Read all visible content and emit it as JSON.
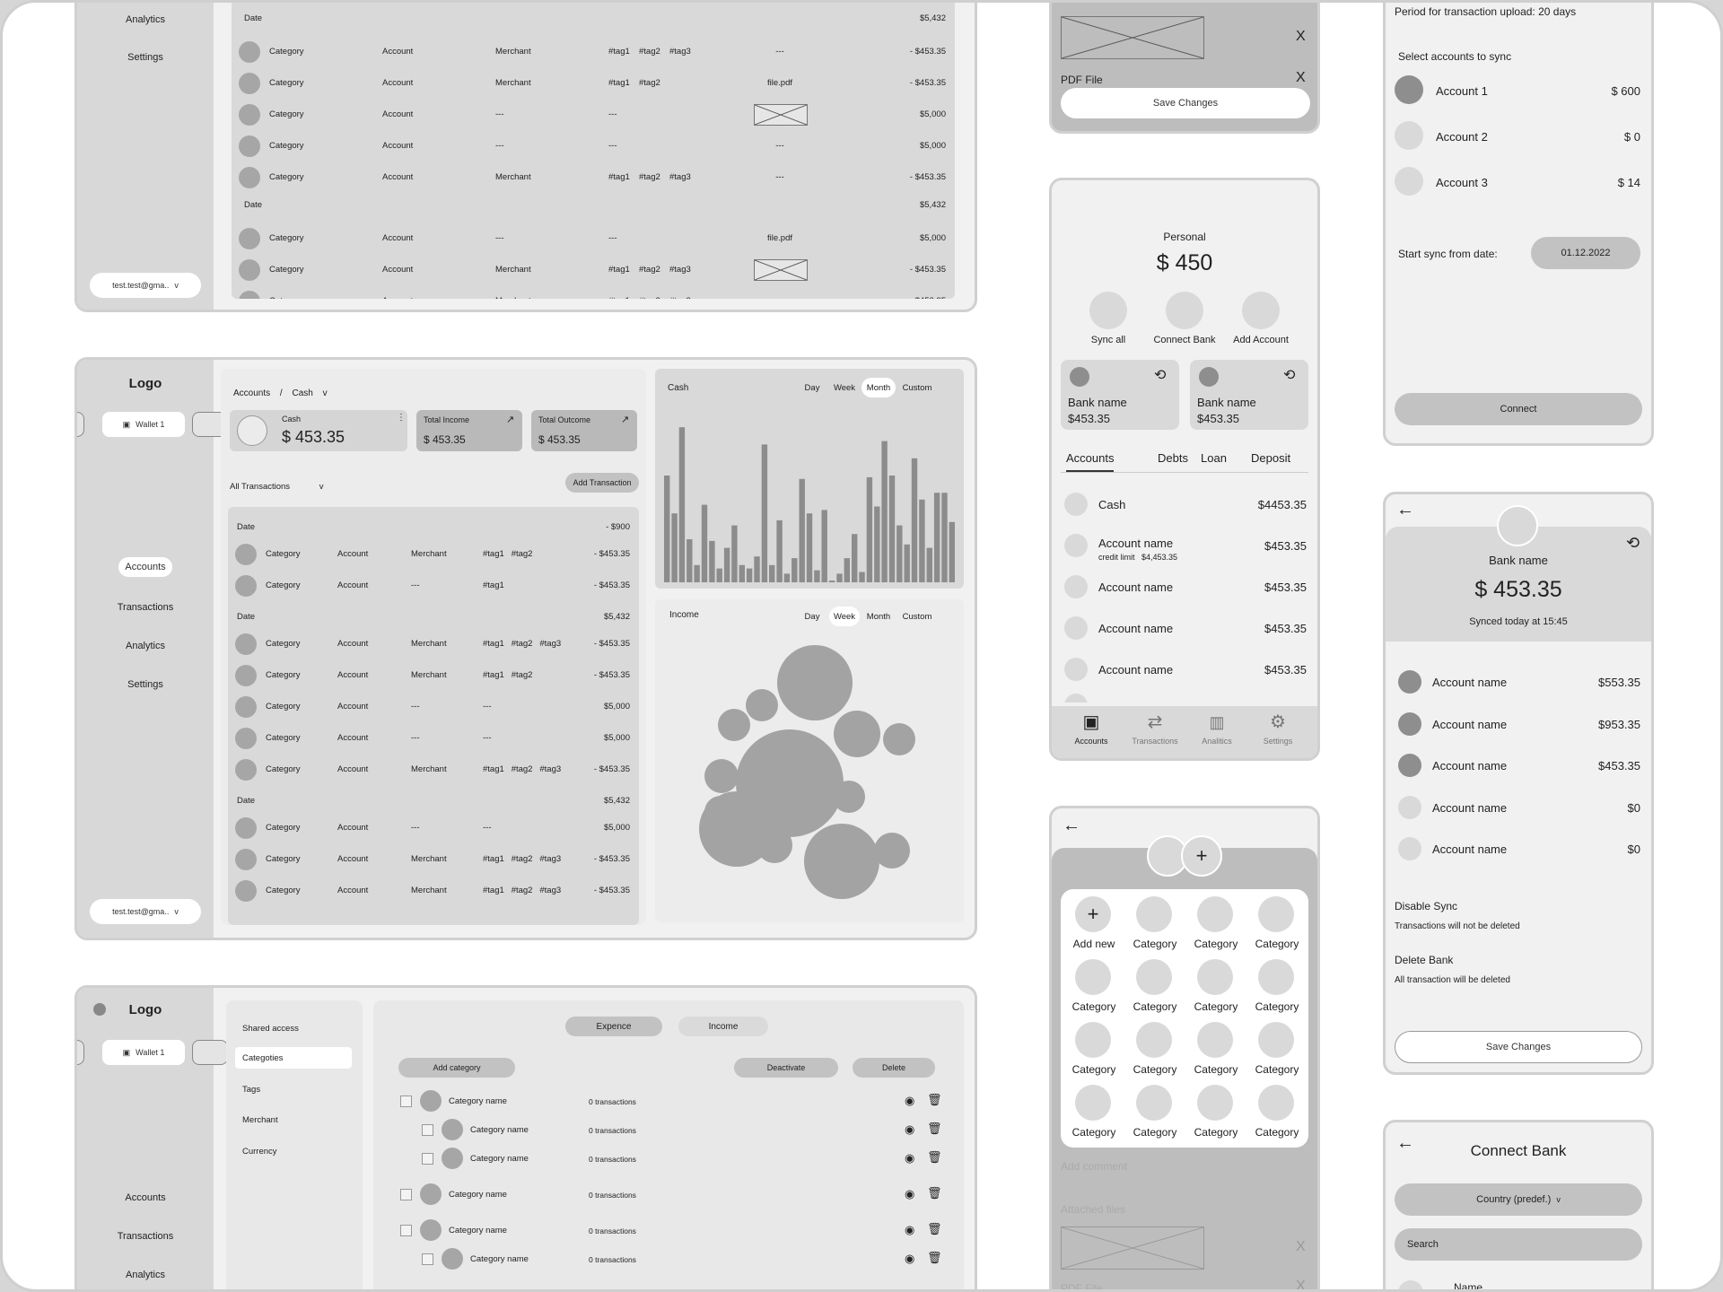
{
  "sidebar": {
    "analytics": "Analytics",
    "settings": "Settings",
    "accounts": "Accounts",
    "transactions": "Transactions",
    "logo": "Logo",
    "wallet": "Wallet 1",
    "email": "test.test@gma..",
    "chevron": "v"
  },
  "top_table": {
    "groups": [
      {
        "date": "Date",
        "total": "$5,432"
      },
      {
        "date": "Date",
        "total": "$5,432"
      }
    ],
    "rows": [
      {
        "category": "Category",
        "account": "Account",
        "merchant": "Merchant",
        "tags": [
          "#tag1",
          "#tag2",
          "#tag3"
        ],
        "file": "---",
        "amount": "- $453.35"
      },
      {
        "category": "Category",
        "account": "Account",
        "merchant": "Merchant",
        "tags": [
          "#tag1",
          "#tag2"
        ],
        "file": "file.pdf",
        "amount": "- $453.35"
      },
      {
        "category": "Category",
        "account": "Account",
        "merchant": "---",
        "tags": [
          "---"
        ],
        "file": "image",
        "amount": "$5,000"
      },
      {
        "category": "Category",
        "account": "Account",
        "merchant": "---",
        "tags": [
          "---"
        ],
        "file": "---",
        "amount": "$5,000"
      },
      {
        "category": "Category",
        "account": "Account",
        "merchant": "Merchant",
        "tags": [
          "#tag1",
          "#tag2",
          "#tag3"
        ],
        "file": "---",
        "amount": "- $453.35"
      },
      {
        "category": "Category",
        "account": "Account",
        "merchant": "---",
        "tags": [
          "---"
        ],
        "file": "file.pdf",
        "amount": "$5,000"
      },
      {
        "category": "Category",
        "account": "Account",
        "merchant": "Merchant",
        "tags": [
          "#tag1",
          "#tag2",
          "#tag3"
        ],
        "file": "image",
        "amount": "- $453.35"
      },
      {
        "category": "Category",
        "account": "Account",
        "merchant": "Merchant",
        "tags": [
          "#tag1",
          "#tag2",
          "#tag3"
        ],
        "file": "---",
        "amount": "- $453.35"
      }
    ]
  },
  "dashboard": {
    "breadcrumb_root": "Accounts",
    "breadcrumb_sep": "/",
    "breadcrumb_current": "Cash",
    "cash_label": "Cash",
    "cash_value": "$ 453.35",
    "income_label": "Total Income",
    "income_value": "$ 453.35",
    "outcome_label": "Total Outcome",
    "outcome_value": "$ 453.35",
    "filter": "All Transactions",
    "add_transaction": "Add Transaction",
    "groups": [
      {
        "date": "Date",
        "total": "- $900"
      },
      {
        "date": "Date",
        "total": "$5,432"
      },
      {
        "date": "Date",
        "total": "$5,432"
      }
    ],
    "rows": [
      {
        "category": "Category",
        "account": "Account",
        "merchant": "Merchant",
        "tags": "#tag1   #tag2",
        "amount": "- $453.35"
      },
      {
        "category": "Category",
        "account": "Account",
        "merchant": "---",
        "tags": "#tag1",
        "amount": "- $453.35"
      },
      {
        "category": "Category",
        "account": "Account",
        "merchant": "Merchant",
        "tags": "#tag1   #tag2   #tag3",
        "amount": "- $453.35"
      },
      {
        "category": "Category",
        "account": "Account",
        "merchant": "Merchant",
        "tags": "#tag1   #tag2",
        "amount": "- $453.35"
      },
      {
        "category": "Category",
        "account": "Account",
        "merchant": "---",
        "tags": "---",
        "amount": "$5,000"
      },
      {
        "category": "Category",
        "account": "Account",
        "merchant": "---",
        "tags": "---",
        "amount": "$5,000"
      },
      {
        "category": "Category",
        "account": "Account",
        "merchant": "Merchant",
        "tags": "#tag1   #tag2   #tag3",
        "amount": "- $453.35"
      },
      {
        "category": "Category",
        "account": "Account",
        "merchant": "---",
        "tags": "---",
        "amount": "$5,000"
      },
      {
        "category": "Category",
        "account": "Account",
        "merchant": "Merchant",
        "tags": "#tag1   #tag2   #tag3",
        "amount": "- $453.35"
      },
      {
        "category": "Category",
        "account": "Account",
        "merchant": "Merchant",
        "tags": "#tag1   #tag2   #tag3",
        "amount": "- $453.35"
      }
    ]
  },
  "charts": {
    "periods": [
      "Day",
      "Week",
      "Month",
      "Custom"
    ],
    "cash_title": "Cash",
    "cash_active": "Month",
    "income_title": "Income",
    "income_active": "Week"
  },
  "chart_data": [
    {
      "type": "bar",
      "title": "Cash",
      "values": [
        62,
        40,
        90,
        25,
        10,
        45,
        24,
        8,
        20,
        33,
        10,
        8,
        15,
        80,
        10,
        36,
        5,
        14,
        60,
        40,
        7,
        42,
        1,
        5,
        14,
        28,
        6,
        61,
        44,
        82,
        62,
        33,
        22,
        72,
        48,
        20,
        52,
        52,
        35
      ],
      "ylim": [
        0,
        100
      ]
    },
    {
      "type": "bubble",
      "title": "Income",
      "values": [
        35,
        16,
        16,
        48,
        24,
        17,
        16,
        16,
        16,
        35,
        18,
        18,
        35
      ]
    }
  ],
  "categories_page": {
    "logo": "Logo",
    "wallet": "Wallet 1",
    "menu": [
      "Shared access",
      "Categoties",
      "Tags",
      "Merchant",
      "Currency"
    ],
    "active_menu": "Categoties",
    "nav": [
      "Accounts",
      "Transactions",
      "Analytics"
    ],
    "toggle_expense": "Expence",
    "toggle_income": "Income",
    "add_category": "Add category",
    "deactivate": "Deactivate",
    "delete": "Delete",
    "rows": [
      {
        "name": "Category name",
        "count": "0 transactions",
        "child": false
      },
      {
        "name": "Category name",
        "count": "0 transactions",
        "child": true
      },
      {
        "name": "Category name",
        "count": "0 transactions",
        "child": true
      },
      {
        "name": "Category name",
        "count": "0 transactions",
        "child": false
      },
      {
        "name": "Category name",
        "count": "0 transactions",
        "child": false
      },
      {
        "name": "Category name",
        "count": "0 transactions",
        "child": true
      }
    ]
  },
  "edit_panel": {
    "pdf_label": "PDF File",
    "close": "X",
    "save": "Save Changes"
  },
  "mobile_accounts": {
    "wallet_name": "Personal",
    "balance": "$ 450",
    "actions": [
      "Sync all",
      "Connect Bank",
      "Add Account"
    ],
    "banks": [
      {
        "name": "Bank name",
        "amount": "$453.35"
      },
      {
        "name": "Bank name",
        "amount": "$453.35"
      }
    ],
    "tabs": [
      "Accounts",
      "Debts",
      "Loan",
      "Deposit"
    ],
    "active_tab": "Accounts",
    "accounts": [
      {
        "name": "Cash",
        "sub": "",
        "amount": "$4453.35"
      },
      {
        "name": "Account name",
        "sub": "credit limit   $4,453.35",
        "amount": "$453.35"
      },
      {
        "name": "Account name",
        "sub": "",
        "amount": "$453.35"
      },
      {
        "name": "Account name",
        "sub": "",
        "amount": "$453.35"
      },
      {
        "name": "Account name",
        "sub": "",
        "amount": "$453.35"
      }
    ],
    "bottom_nav": [
      "Accounts",
      "Transactions",
      "Analitics",
      "Settings"
    ]
  },
  "mobile_category": {
    "add_new": "Add new",
    "category": "Category",
    "add_comment": "Add comment",
    "attached_files": "Attached files",
    "pdf_label": "PDF File",
    "close": "X"
  },
  "sync_setup": {
    "period": "Period for transaction upload: 20 days",
    "select_label": "Select accounts to sync",
    "accounts": [
      {
        "name": "Account 1",
        "amount": "$ 600"
      },
      {
        "name": "Account 2",
        "amount": "$ 0"
      },
      {
        "name": "Account 3",
        "amount": "$ 14"
      }
    ],
    "start_label": "Start sync from date:",
    "start_date": "01.12.2022",
    "connect": "Connect"
  },
  "bank_detail": {
    "bank_name": "Bank name",
    "balance": "$ 453.35",
    "synced": "Synced today at 15:45",
    "accounts": [
      {
        "name": "Account name",
        "amount": "$553.35"
      },
      {
        "name": "Account name",
        "amount": "$953.35"
      },
      {
        "name": "Account name",
        "amount": "$453.35"
      },
      {
        "name": "Account name",
        "amount": "$0"
      },
      {
        "name": "Account name",
        "amount": "$0"
      }
    ],
    "disable_title": "Disable Sync",
    "disable_desc": "Transactions will not be deleted",
    "delete_title": "Delete Bank",
    "delete_desc": "All transaction will be deleted",
    "save": "Save Changes"
  },
  "connect_bank": {
    "title": "Connect Bank",
    "country": "Country (predef.)",
    "search": "Search",
    "name_col": "Name"
  },
  "colors": {
    "panel": "#d9d9d9",
    "sidebar": "#d8d8d8",
    "bg": "#f1f1f1",
    "dot": "#a6a6a6"
  }
}
